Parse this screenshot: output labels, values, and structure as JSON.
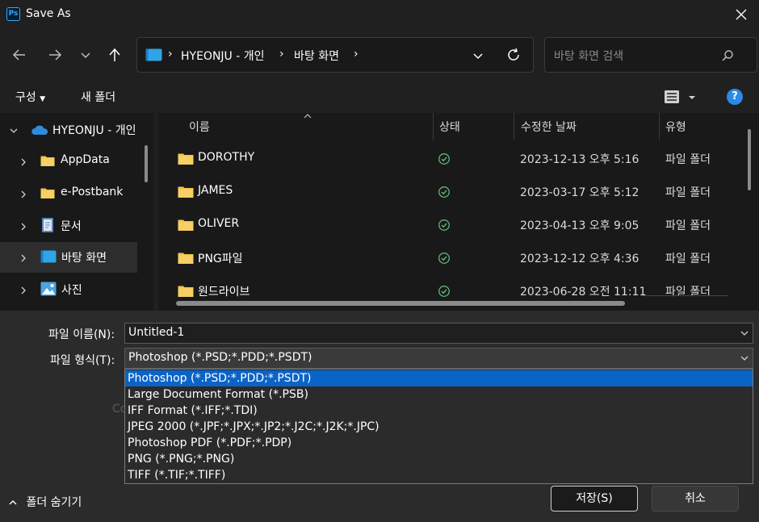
{
  "window": {
    "title": "Save As",
    "app_icon_text": "Ps"
  },
  "address": {
    "crumbs": [
      "HYEONJU - 개인",
      "바탕 화면"
    ]
  },
  "search": {
    "placeholder": "바탕 화면 검색"
  },
  "commands": {
    "organize": "구성",
    "new_folder": "새 폴더"
  },
  "navpane": {
    "items": [
      {
        "label": "HYEONJU - 개인",
        "icon": "onedrive-cloud-icon",
        "expanded": true
      },
      {
        "label": "AppData",
        "icon": "folder-icon"
      },
      {
        "label": "e-Postbank",
        "icon": "folder-icon"
      },
      {
        "label": "문서",
        "icon": "documents-icon"
      },
      {
        "label": "바탕 화면",
        "icon": "desktop-icon",
        "selected": true
      },
      {
        "label": "사진",
        "icon": "pictures-icon"
      }
    ]
  },
  "filelist": {
    "columns": {
      "name": "이름",
      "status": "상태",
      "date": "수정한 날짜",
      "type": "유형"
    },
    "rows": [
      {
        "name": "DOROTHY",
        "status": "synced",
        "date": "2023-12-13 오후 5:16",
        "type": "파일 폴더"
      },
      {
        "name": "JAMES",
        "status": "synced",
        "date": "2023-03-17 오후 5:12",
        "type": "파일 폴더"
      },
      {
        "name": "OLIVER",
        "status": "synced",
        "date": "2023-04-13 오후 9:05",
        "type": "파일 폴더"
      },
      {
        "name": "PNG파일",
        "status": "synced",
        "date": "2023-12-12 오후 4:36",
        "type": "파일 폴더"
      },
      {
        "name": "원드라이브",
        "status": "synced",
        "date": "2023-06-28 오전 11:11",
        "type": "파일 폴더"
      }
    ]
  },
  "form": {
    "filename_label": "파일 이름(N):",
    "filename_value": "Untitled-1",
    "filetype_label": "파일 형식(T):",
    "filetype_value": "Photoshop (*.PSD;*.PDD;*.PSDT)",
    "filetype_options": [
      "Photoshop (*.PSD;*.PDD;*.PSDT)",
      "Large Document Format (*.PSB)",
      "IFF Format (*.IFF;*.TDI)",
      "JPEG 2000 (*.JPF;*.JPX;*.JP2;*.J2C;*.J2K;*.JPC)",
      "Photoshop PDF (*.PDF;*.PDP)",
      "PNG (*.PNG;*.PNG)",
      "TIFF (*.TIF;*.TIFF)"
    ],
    "selected_option_index": 0,
    "ghost_text": "Co"
  },
  "footer": {
    "hide_folders": "폴더 숨기기",
    "save": "저장(S)",
    "cancel": "취소"
  },
  "colors": {
    "accent": "#0a64c8",
    "folder": "#f4c44e",
    "synced": "#5fb878",
    "help": "#2a8ae6"
  }
}
